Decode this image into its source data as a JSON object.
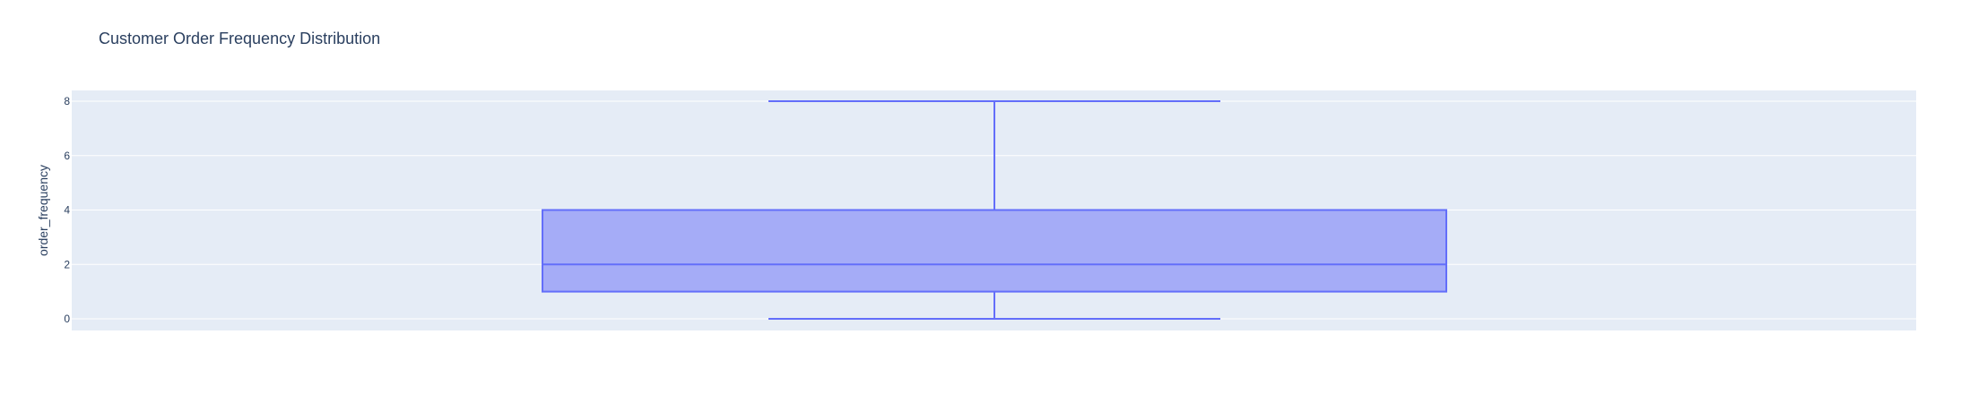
{
  "chart_data": {
    "type": "box",
    "title": "Customer Order Frequency Distribution",
    "xlabel": "",
    "ylabel": "order_frequency",
    "ylim": [
      -0.4,
      8.4
    ],
    "y_ticks": [
      0,
      2,
      4,
      6,
      8
    ],
    "grid": true,
    "series": [
      {
        "min": 0,
        "q1": 1,
        "median": 2,
        "q3": 4,
        "max": 8
      }
    ],
    "colors": {
      "plot_bg": "#e5ecf6",
      "grid": "#ffffff",
      "box_fill": "#a5acf7",
      "box_line": "#636efa",
      "text": "#2a3f5f"
    }
  }
}
